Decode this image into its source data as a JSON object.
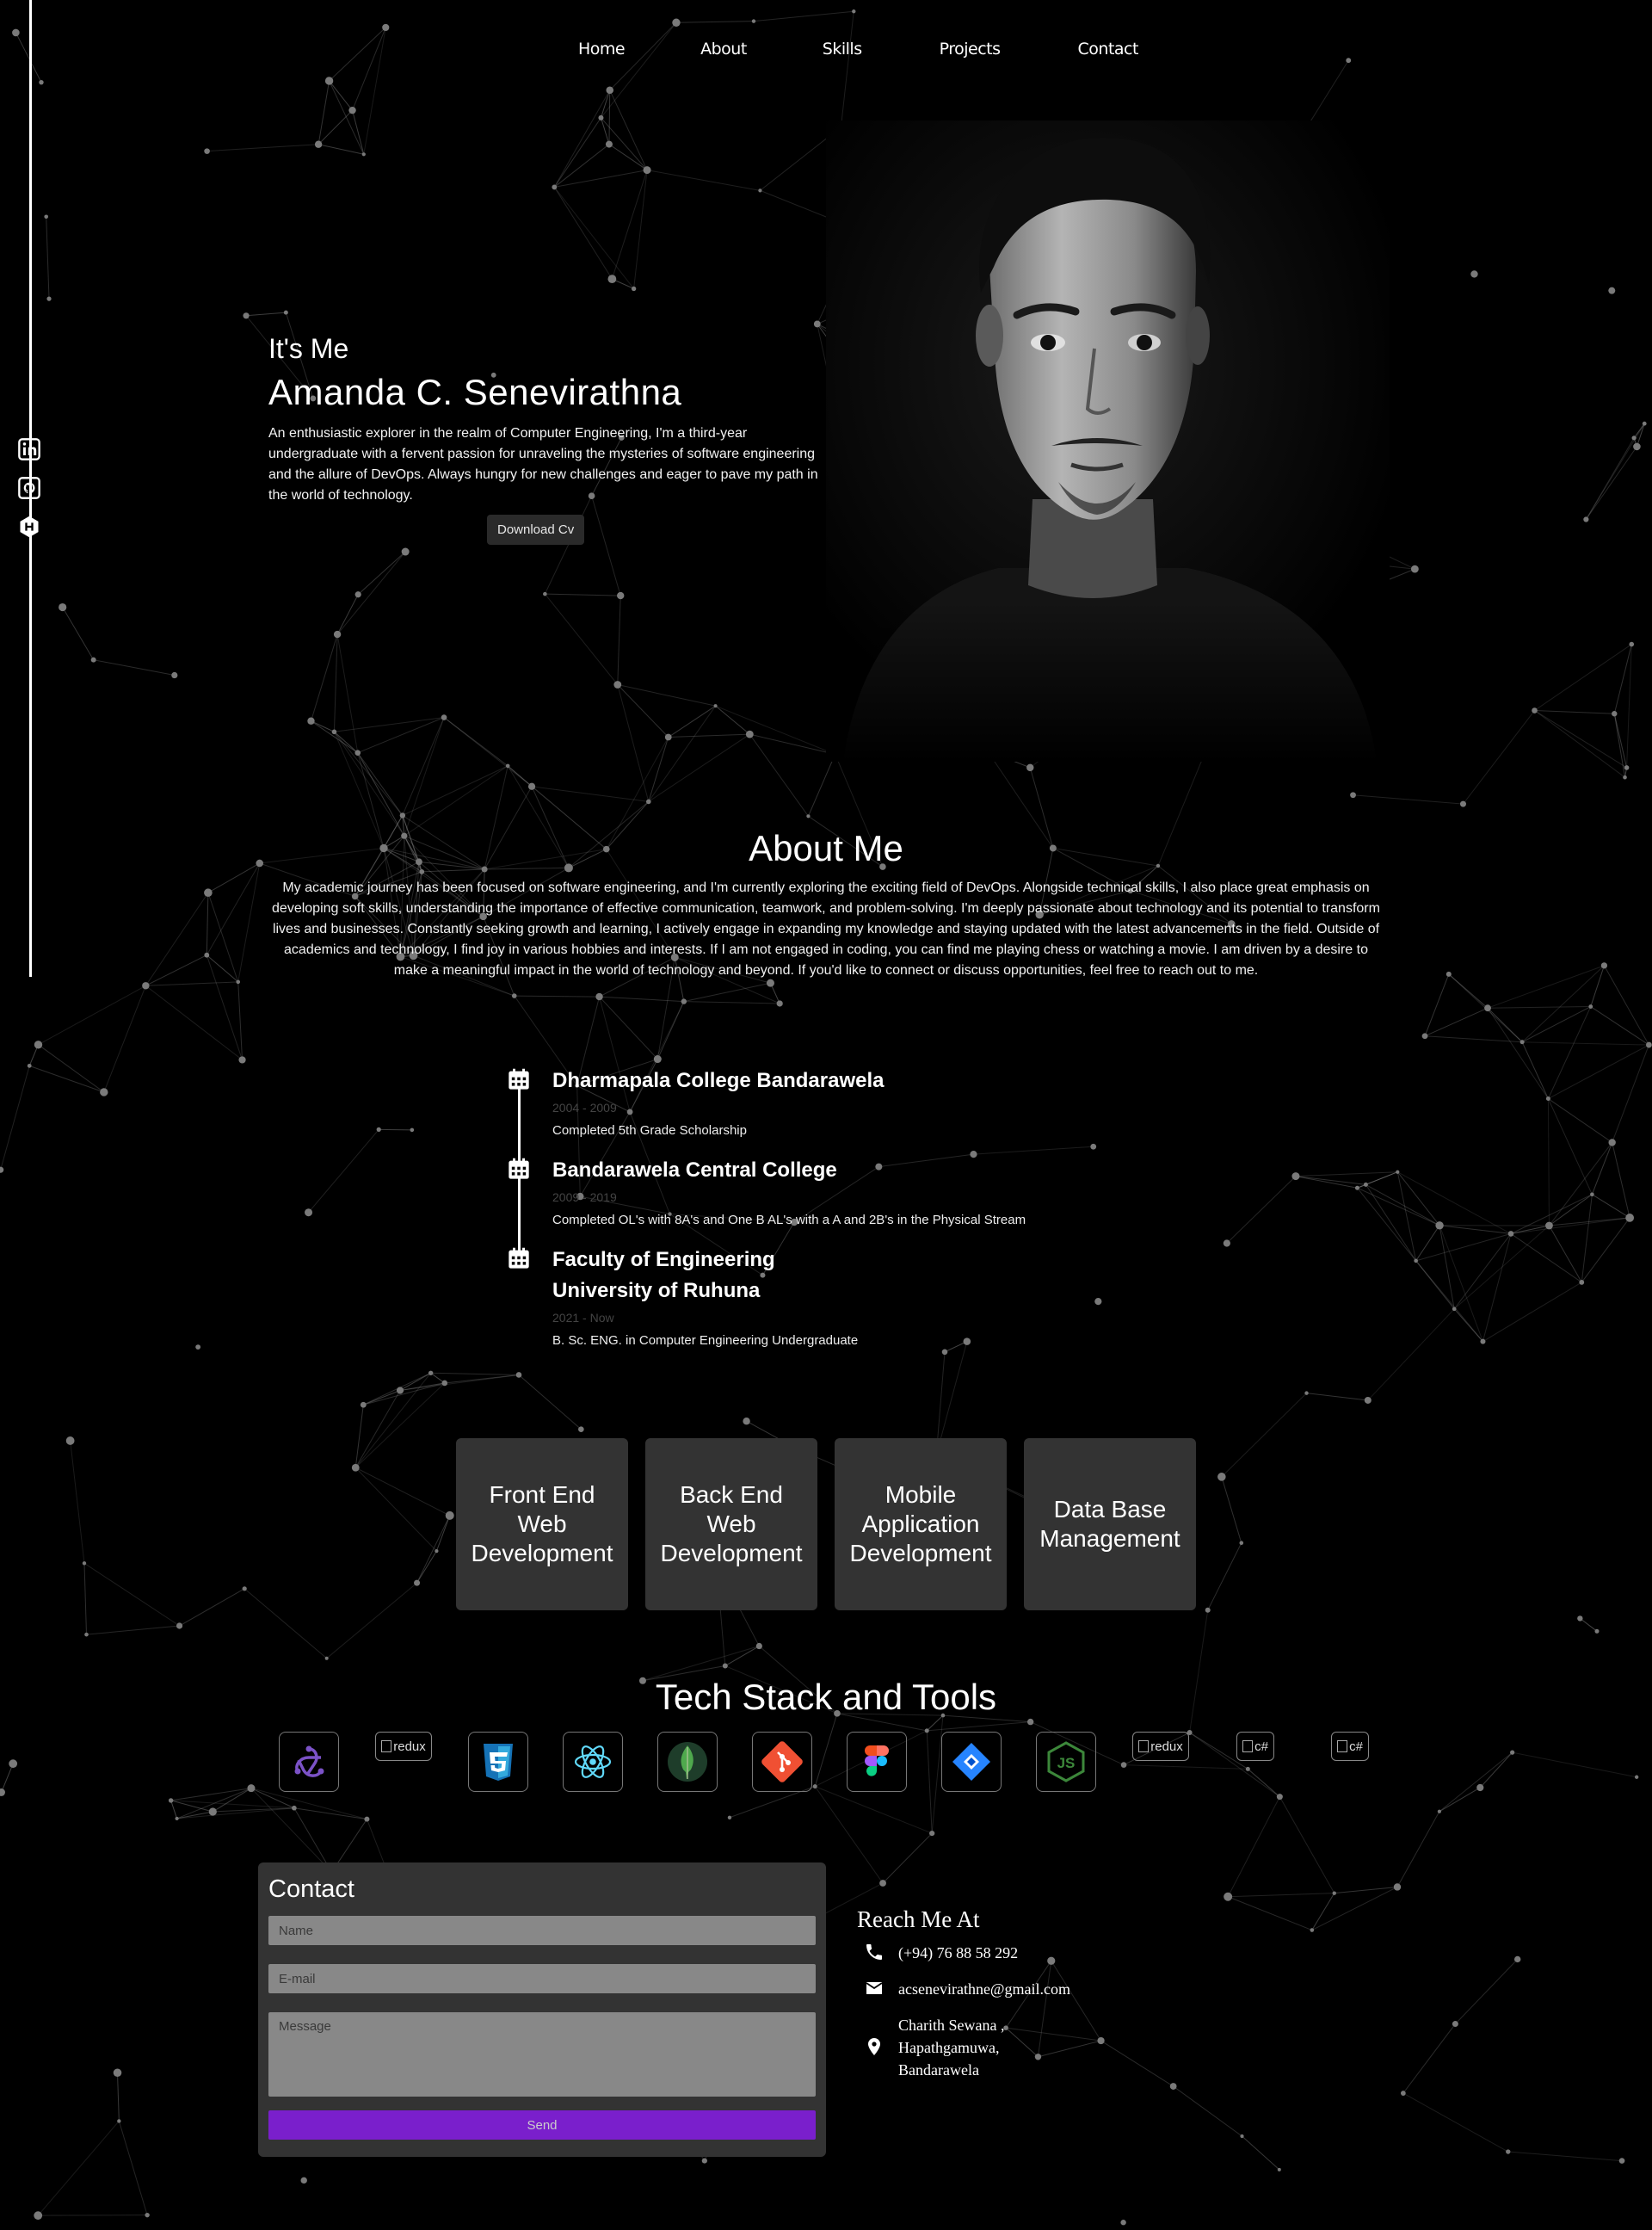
{
  "nav": {
    "items": [
      "Home",
      "About",
      "Skills",
      "Projects",
      "Contact"
    ]
  },
  "social": [
    "linkedin-icon",
    "github-icon",
    "hashnode-icon"
  ],
  "hero": {
    "intro": "It's Me",
    "name": "Amanda C. Senevirathna",
    "description": "An enthusiastic explorer in the realm of Computer Engineering, I'm a third-year undergraduate with a fervent passion for unraveling the mysteries of software engineering and the allure of DevOps. Always hungry for new challenges and eager to pave my path in the world of technology.",
    "cv_button": "Download Cv"
  },
  "about": {
    "title": "About Me",
    "text": "My academic journey has been focused on software engineering, and I'm currently exploring the exciting field of DevOps. Alongside technical skills, I also place great emphasis on developing soft skills, understanding the importance of effective communication, teamwork, and problem-solving. I'm deeply passionate about technology and its potential to transform lives and businesses. Constantly seeking growth and learning, I actively engage in expanding my knowledge and staying updated with the latest advancements in the field. Outside of academics and technology, I find joy in various hobbies and interests. If I am not engaged in coding, you can find me playing chess or watching a movie. I am driven by a desire to make a meaningful impact in the world of technology and beyond. If you'd like to connect or discuss opportunities, feel free to reach out to me."
  },
  "timeline": [
    {
      "title": "Dharmapala College Bandarawela",
      "date": "2004 - 2009",
      "desc": "Completed 5th Grade Scholarship"
    },
    {
      "title": "Bandarawela Central College",
      "date": "2009 - 2019",
      "desc": "Completed OL's with 8A's and One B AL's with a A and 2B's in the Physical Stream"
    },
    {
      "title": "Faculty of Engineering University of Ruhuna",
      "date": "2021 - Now",
      "desc": "B. Sc. ENG. in Computer Engineering Undergraduate"
    }
  ],
  "services": [
    "Front End Web Development",
    "Back End Web Development",
    "Mobile Application Development",
    "Data Base Management"
  ],
  "tech": {
    "title": "Tech Stack and Tools",
    "items": [
      {
        "icon": "redux-icon",
        "alt": ""
      },
      {
        "icon": "broken-image",
        "alt": "redux"
      },
      {
        "icon": "css3-icon",
        "alt": ""
      },
      {
        "icon": "react-icon",
        "alt": ""
      },
      {
        "icon": "mongodb-icon",
        "alt": ""
      },
      {
        "icon": "git-icon",
        "alt": ""
      },
      {
        "icon": "figma-icon",
        "alt": ""
      },
      {
        "icon": "jira-icon",
        "alt": ""
      },
      {
        "icon": "nodejs-icon",
        "alt": ""
      },
      {
        "icon": "broken-image",
        "alt": "redux"
      },
      {
        "icon": "broken-image",
        "alt": "c#"
      },
      {
        "icon": "broken-image",
        "alt": "c#"
      }
    ]
  },
  "contact": {
    "title": "Contact",
    "name_placeholder": "Name",
    "email_placeholder": "E-mail",
    "message_placeholder": "Message",
    "send": "Send"
  },
  "reach": {
    "title": "Reach Me At",
    "phone": "(+94) 76 88 58 292",
    "email": "acsenevirathne@gmail.com",
    "address_line1": "Charith Sewana ,",
    "address_line2": "Hapathgamuwa,",
    "address_line3": "Bandarawela"
  },
  "colors": {
    "background": "#000000",
    "card": "#333333",
    "accent": "#7a1fcc"
  }
}
